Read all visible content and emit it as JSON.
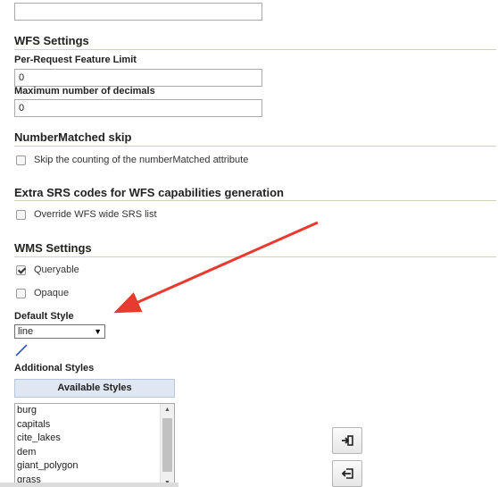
{
  "top_input": {
    "value": ""
  },
  "wfs": {
    "title": "WFS Settings",
    "feature_limit_label": "Per-Request Feature Limit",
    "feature_limit_value": "0",
    "decimals_label": "Maximum number of decimals",
    "decimals_value": "0"
  },
  "number_matched": {
    "title": "NumberMatched skip",
    "checkbox_label": "Skip the counting of the numberMatched attribute",
    "checked": false
  },
  "extra_srs": {
    "title": "Extra SRS codes for WFS capabilities generation",
    "checkbox_label": "Override WFS wide SRS list",
    "checked": false
  },
  "wms": {
    "title": "WMS Settings",
    "queryable_label": "Queryable",
    "queryable_checked": true,
    "opaque_label": "Opaque",
    "opaque_checked": false,
    "default_style_label": "Default Style",
    "default_style_value": "line",
    "additional_styles_label": "Additional Styles",
    "available_styles_header": "Available Styles",
    "available_styles": [
      "burg",
      "capitals",
      "cite_lakes",
      "dem",
      "giant_polygon",
      "grass"
    ]
  },
  "icons": {
    "select_arrow": "dropdown-arrow-icon",
    "style_preview": "line-style-preview-icon",
    "add": "arrow-right-into-box-icon",
    "remove": "arrow-left-out-of-box-icon",
    "annotation": "red-arrow-annotation"
  },
  "colors": {
    "section_rule": "#cfd6b4",
    "header_bg": "#dfe7f3",
    "annotation_arrow": "#e83a2e",
    "line_preview": "#1f3fbf"
  }
}
